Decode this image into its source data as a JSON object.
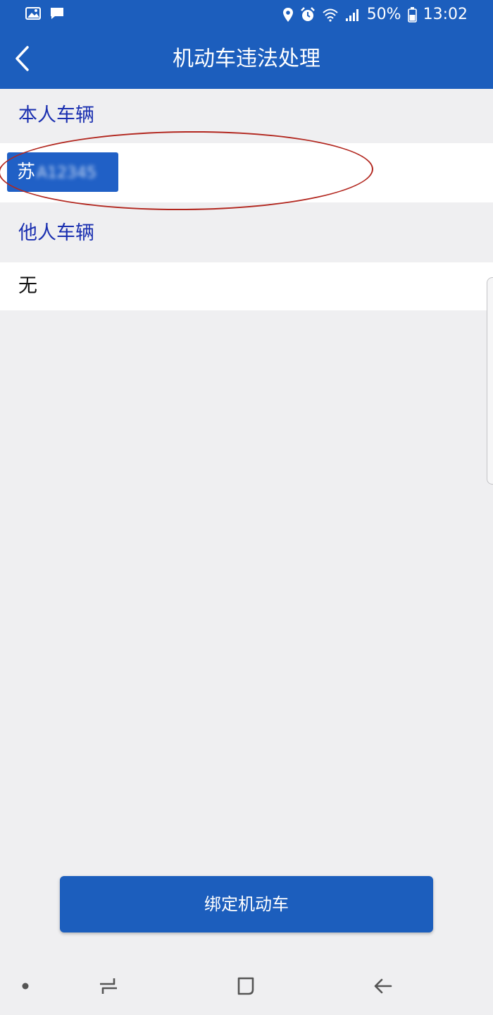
{
  "status_bar": {
    "left_icons": [
      "image-icon",
      "message-icon"
    ],
    "right_icons": [
      "location-icon",
      "alarm-icon",
      "wifi-icon",
      "signal-icon"
    ],
    "battery_percent": "50%",
    "time": "13:02"
  },
  "header": {
    "title": "机动车违法处理",
    "back_icon": "chevron-left-icon"
  },
  "sections": {
    "own_vehicles": {
      "heading": "本人车辆",
      "plate_prefix": "苏",
      "plate_masked": "A12345"
    },
    "others_vehicles": {
      "heading": "他人车辆",
      "empty_text": "无"
    }
  },
  "bind_button": {
    "label": "绑定机动车"
  },
  "nav_bar": {
    "items": [
      "dot-icon",
      "recent-apps-icon",
      "home-icon",
      "back-arrow-icon"
    ]
  },
  "colors": {
    "brand": "#1c5ebd",
    "section_heading": "#1a2fb0",
    "annotation": "#b2271f",
    "background": "#efeff1"
  }
}
